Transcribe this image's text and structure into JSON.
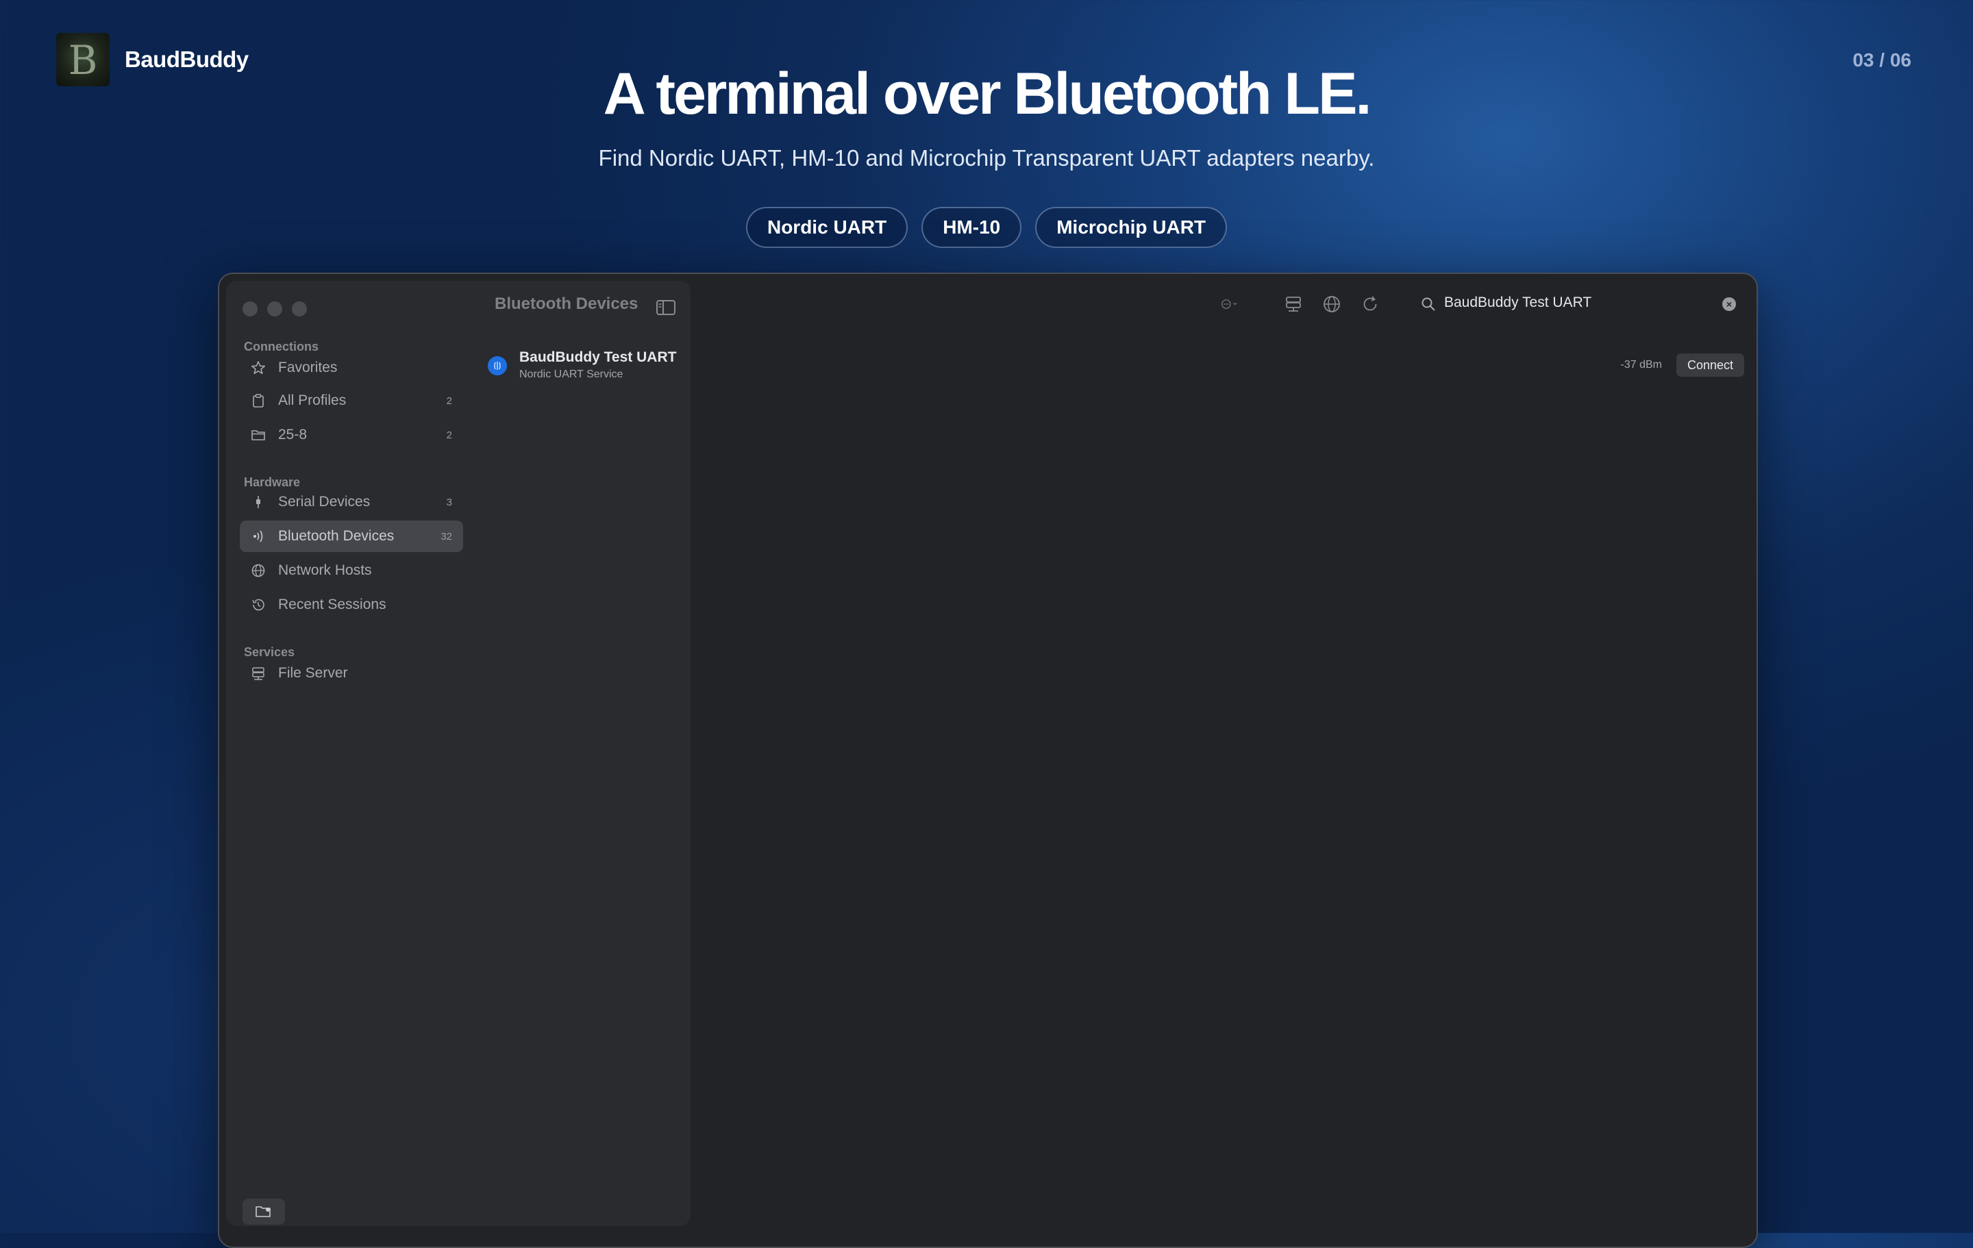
{
  "brand": {
    "name": "BaudBuddy",
    "logo_letter": "B"
  },
  "page_indicator": "03 / 06",
  "hero": {
    "title": "A terminal over Bluetooth LE.",
    "subtitle": "Find Nordic UART, HM-10 and Microchip Transparent UART adapters nearby.",
    "chips": [
      "Nordic UART",
      "HM-10",
      "Microchip UART"
    ]
  },
  "sidebar": {
    "sections": [
      {
        "label": "Connections",
        "items": [
          {
            "label": "Favorites",
            "icon": "star-icon",
            "count": ""
          },
          {
            "label": "All Profiles",
            "icon": "clipboard-icon",
            "count": "2"
          },
          {
            "label": "25-8",
            "icon": "folder-icon",
            "count": "2"
          }
        ]
      },
      {
        "label": "Hardware",
        "items": [
          {
            "label": "Serial Devices",
            "icon": "usb-plug-icon",
            "count": "3"
          },
          {
            "label": "Bluetooth Devices",
            "icon": "wireless-icon",
            "count": "32",
            "selected": true
          },
          {
            "label": "Network Hosts",
            "icon": "globe-icon",
            "count": ""
          },
          {
            "label": "Recent Sessions",
            "icon": "history-icon",
            "count": ""
          }
        ]
      },
      {
        "label": "Services",
        "items": [
          {
            "label": "File Server",
            "icon": "server-icon",
            "count": ""
          }
        ]
      }
    ]
  },
  "toolbar": {
    "title": "Bluetooth Devices",
    "search_value": "BaudBuddy Test UART",
    "icons": [
      "more-options-icon",
      "server-icon",
      "globe-icon",
      "refresh-icon"
    ]
  },
  "devices": [
    {
      "name": "BaudBuddy Test UART",
      "service": "Nordic UART Service",
      "rssi": "-37 dBm",
      "action": "Connect"
    }
  ],
  "colors": {
    "accent": "#1e6fe0",
    "window_bg": "#222326",
    "sidebar_bg": "#2a2b2e",
    "selected_bg": "#45464b"
  }
}
